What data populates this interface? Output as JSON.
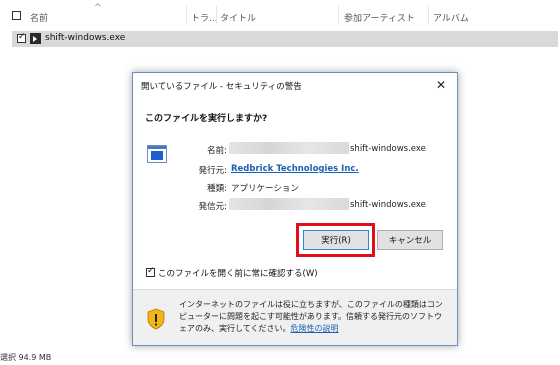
{
  "explorer": {
    "columns": {
      "name": "名前",
      "track": "トラ...",
      "title": "タイトル",
      "artist": "参加アーティスト",
      "album": "アルバム"
    },
    "file": {
      "name": "shift-windows.exe"
    },
    "status": "選択  94.9 MB"
  },
  "dialog": {
    "title": "開いているファイル - セキュリティの警告",
    "close": "✕",
    "question": "このファイルを実行しますか?",
    "fields": {
      "name_label": "名前:",
      "name_value": "shift-windows.exe",
      "publisher_label": "発行元:",
      "publisher_value": "Redbrick Technologies Inc.",
      "type_label": "種類:",
      "type_value": "アプリケーション",
      "from_label": "発信元:",
      "from_value": "shift-windows.exe"
    },
    "buttons": {
      "run": "実行(R)",
      "cancel": "キャンセル"
    },
    "always_ask": {
      "label": "このファイルを開く前に常に確認する(W)",
      "checked": true
    },
    "warning": {
      "text": "インターネットのファイルは役に立ちますが、このファイルの種類はコンピューターに問題を起こす可能性があります。信頼する発行元のソフトウェアのみ、実行してください。",
      "link": "危険性の説明"
    },
    "colors": {
      "highlight": "#e0101a",
      "link": "#1a5fb4"
    }
  }
}
